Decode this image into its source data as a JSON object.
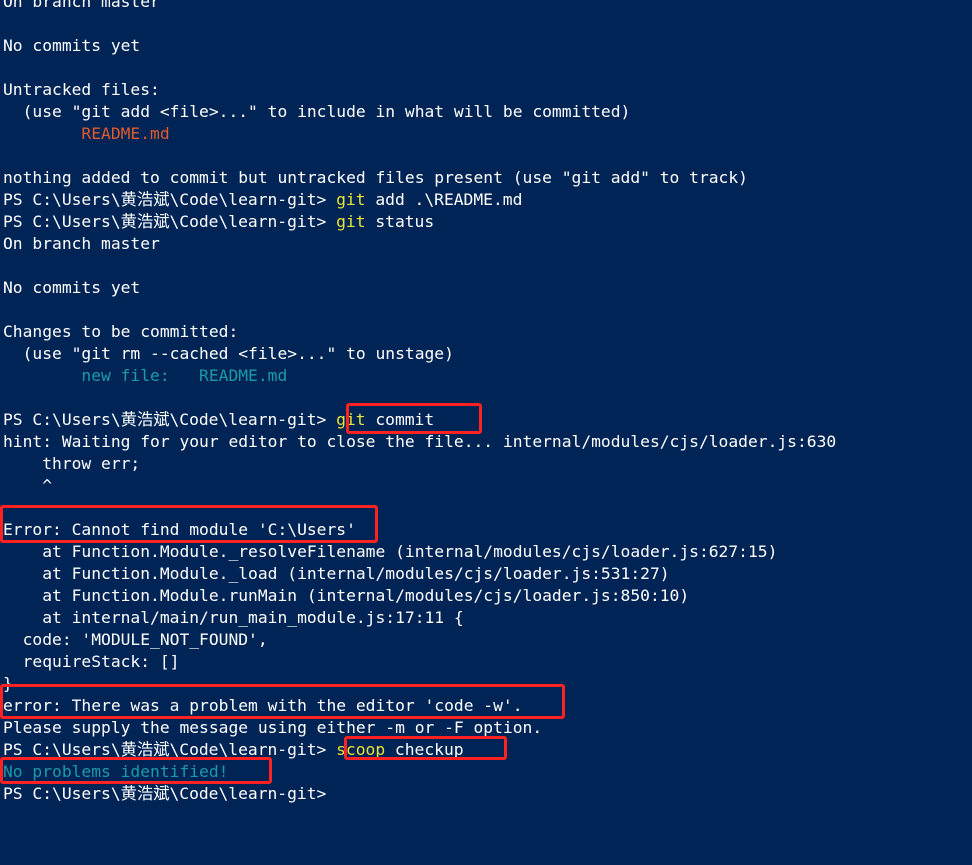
{
  "colors": {
    "background": "#012456",
    "default_text": "#ffffff",
    "command_keyword": "#e8e337",
    "untracked_file": "#e05c2c",
    "staged_file": "#1a9ba8",
    "highlight_box": "#ff2222"
  },
  "terminal": {
    "lines": [
      [
        {
          "t": "On branch master",
          "c": "default"
        }
      ],
      [
        {
          "t": "",
          "c": "default"
        }
      ],
      [
        {
          "t": "No commits yet",
          "c": "default"
        }
      ],
      [
        {
          "t": "",
          "c": "default"
        }
      ],
      [
        {
          "t": "Untracked files:",
          "c": "default"
        }
      ],
      [
        {
          "t": "  (use \"git add <file>...\" to include in what will be committed)",
          "c": "default"
        }
      ],
      [
        {
          "t": "        README.md",
          "c": "red"
        }
      ],
      [
        {
          "t": "",
          "c": "default"
        }
      ],
      [
        {
          "t": "nothing added to commit but untracked files present (use \"git add\" to track)",
          "c": "default"
        }
      ],
      [
        {
          "t": "PS C:\\Users\\黄浩斌\\Code\\learn-git> ",
          "c": "default"
        },
        {
          "t": "git",
          "c": "yellow"
        },
        {
          "t": " add .\\README.md",
          "c": "default"
        }
      ],
      [
        {
          "t": "PS C:\\Users\\黄浩斌\\Code\\learn-git> ",
          "c": "default"
        },
        {
          "t": "git",
          "c": "yellow"
        },
        {
          "t": " status",
          "c": "default"
        }
      ],
      [
        {
          "t": "On branch master",
          "c": "default"
        }
      ],
      [
        {
          "t": "",
          "c": "default"
        }
      ],
      [
        {
          "t": "No commits yet",
          "c": "default"
        }
      ],
      [
        {
          "t": "",
          "c": "default"
        }
      ],
      [
        {
          "t": "Changes to be committed:",
          "c": "default"
        }
      ],
      [
        {
          "t": "  (use \"git rm --cached <file>...\" to unstage)",
          "c": "default"
        }
      ],
      [
        {
          "t": "        new file:   README.md",
          "c": "cyan"
        }
      ],
      [
        {
          "t": "",
          "c": "default"
        }
      ],
      [
        {
          "t": "PS C:\\Users\\黄浩斌\\Code\\learn-git> ",
          "c": "default"
        },
        {
          "t": "git",
          "c": "yellow"
        },
        {
          "t": " commit",
          "c": "default"
        }
      ],
      [
        {
          "t": "hint: Waiting for your editor to close the file... internal/modules/cjs/loader.js:630",
          "c": "default"
        }
      ],
      [
        {
          "t": "    throw err;",
          "c": "default"
        }
      ],
      [
        {
          "t": "    ^",
          "c": "default"
        }
      ],
      [
        {
          "t": "",
          "c": "default"
        }
      ],
      [
        {
          "t": "Error: Cannot find module 'C:\\Users'",
          "c": "default"
        }
      ],
      [
        {
          "t": "    at Function.Module._resolveFilename (internal/modules/cjs/loader.js:627:15)",
          "c": "default"
        }
      ],
      [
        {
          "t": "    at Function.Module._load (internal/modules/cjs/loader.js:531:27)",
          "c": "default"
        }
      ],
      [
        {
          "t": "    at Function.Module.runMain (internal/modules/cjs/loader.js:850:10)",
          "c": "default"
        }
      ],
      [
        {
          "t": "    at internal/main/run_main_module.js:17:11 {",
          "c": "default"
        }
      ],
      [
        {
          "t": "  code: 'MODULE_NOT_FOUND',",
          "c": "default"
        }
      ],
      [
        {
          "t": "  requireStack: []",
          "c": "default"
        }
      ],
      [
        {
          "t": "}",
          "c": "default"
        }
      ],
      [
        {
          "t": "error: There was a problem with the editor 'code -w'.",
          "c": "default"
        }
      ],
      [
        {
          "t": "Please supply the message using either -m or -F option.",
          "c": "default"
        }
      ],
      [
        {
          "t": "PS C:\\Users\\黄浩斌\\Code\\learn-git> ",
          "c": "default"
        },
        {
          "t": "scoop",
          "c": "yellow"
        },
        {
          "t": " checkup",
          "c": "default"
        }
      ],
      [
        {
          "t": "No problems identified!",
          "c": "cyan"
        }
      ],
      [
        {
          "t": "PS C:\\Users\\黄浩斌\\Code\\learn-git>",
          "c": "default"
        }
      ]
    ]
  }
}
